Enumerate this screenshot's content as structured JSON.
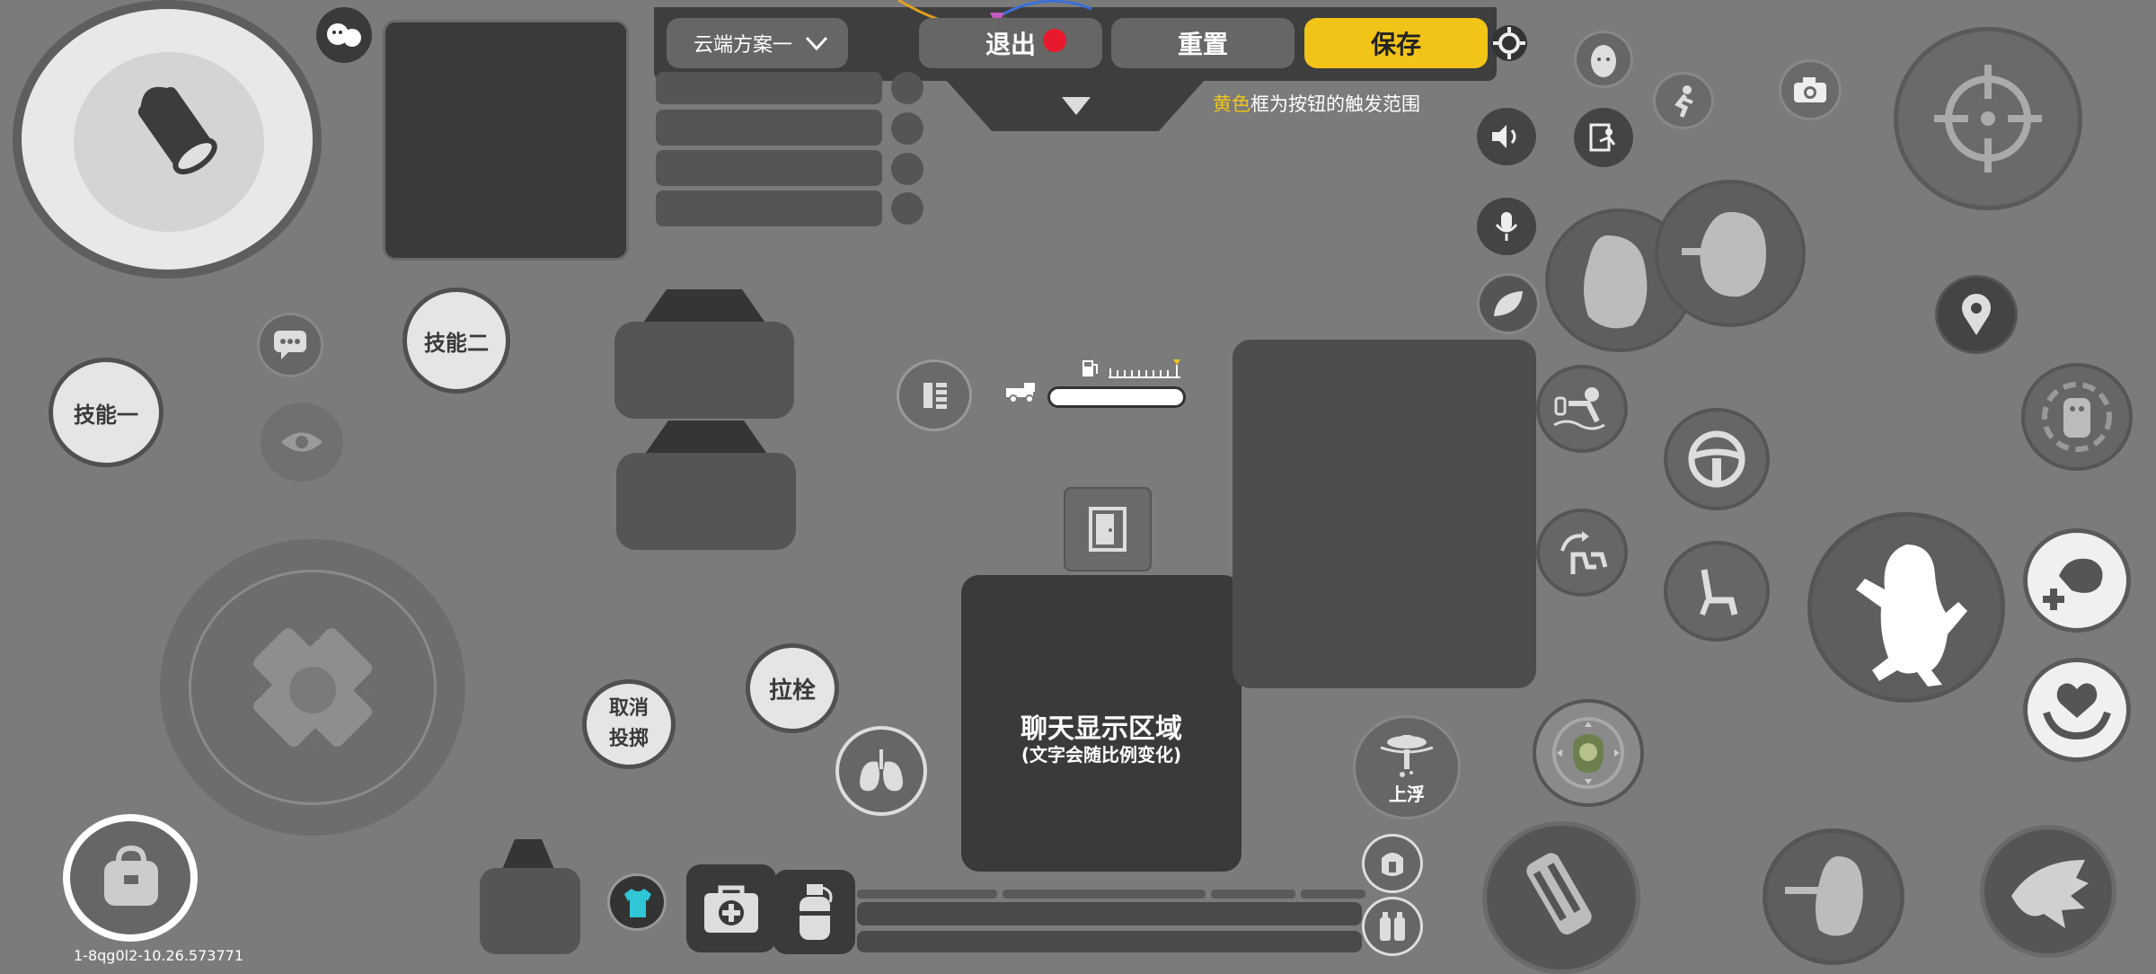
{
  "toolbar": {
    "scheme_label": "云端方案一",
    "exit_label": "退出",
    "reset_label": "重置",
    "save_label": "保存"
  },
  "hint": {
    "highlight": "黄色",
    "text": "框为按钮的触发范围"
  },
  "skills": {
    "skill_one": "技能一",
    "skill_two": "技能二",
    "cancel_throw_line1": "取消",
    "cancel_throw_line2": "投掷",
    "pull_bolt": "拉栓",
    "float_up": "上浮"
  },
  "chat": {
    "title": "聊天显示区域",
    "subtitle": "(文字会随比例变化)"
  },
  "version": "1-8qg0l2-10.26.573771",
  "colors": {
    "background": "#7b7b7b",
    "panel_dark": "#3a3a3a",
    "accent_yellow": "#f2c418",
    "record_red": "#e8192c"
  }
}
